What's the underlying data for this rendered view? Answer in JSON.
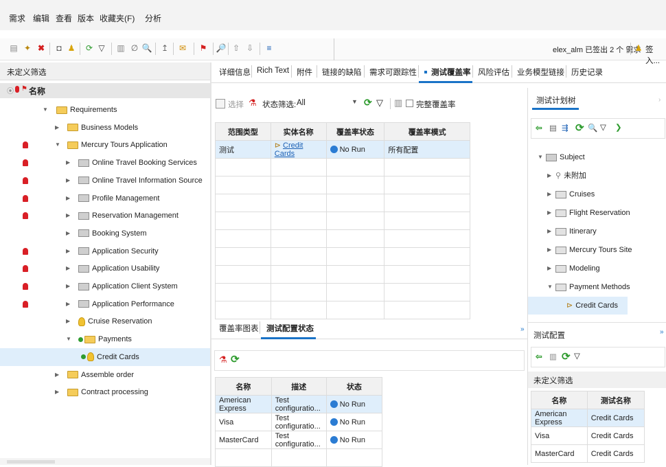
{
  "menu": [
    "需求",
    "编辑",
    "查看",
    "版本",
    "收藏夹(F)",
    "分析"
  ],
  "toolbar": {
    "user_status": "elex_alm 已签出 2 个 需求",
    "login": "签入..."
  },
  "left": {
    "filter_label": "未定义筛选",
    "name_header": "名称",
    "tree": [
      {
        "label": "Requirements",
        "bell": false,
        "arrow": "▼",
        "type": "folder"
      },
      {
        "label": "Business Models",
        "bell": false,
        "arrow": "▶",
        "type": "folder"
      },
      {
        "label": "Mercury Tours Application",
        "bell": true,
        "arrow": "▼",
        "type": "folder"
      },
      {
        "label": "Online Travel Booking Services",
        "bell": true,
        "arrow": "▶",
        "type": "gfolder"
      },
      {
        "label": "Online Travel Information Source",
        "bell": true,
        "arrow": "▶",
        "type": "gfolder"
      },
      {
        "label": "Profile Management",
        "bell": true,
        "arrow": "▶",
        "type": "gfolder"
      },
      {
        "label": "Reservation Management",
        "bell": true,
        "arrow": "▶",
        "type": "gfolder"
      },
      {
        "label": "Booking System",
        "bell": false,
        "arrow": "▶",
        "type": "gfolder"
      },
      {
        "label": "Application Security",
        "bell": true,
        "arrow": "▶",
        "type": "gfolder"
      },
      {
        "label": "Application Usability",
        "bell": true,
        "arrow": "▶",
        "type": "gfolder"
      },
      {
        "label": "Application Client System",
        "bell": true,
        "arrow": "▶",
        "type": "gfolder"
      },
      {
        "label": "Application Performance",
        "bell": true,
        "arrow": "▶",
        "type": "gfolder"
      },
      {
        "label": "Cruise Reservation",
        "bell": false,
        "arrow": "▶",
        "type": "bulb"
      },
      {
        "label": "Payments",
        "bell": false,
        "arrow": "▼",
        "type": "folder"
      },
      {
        "label": "Credit Cards",
        "bell": false,
        "arrow": "",
        "type": "bulb"
      },
      {
        "label": "Assemble order",
        "bell": false,
        "arrow": "▶",
        "type": "folder"
      },
      {
        "label": "Contract processing",
        "bell": false,
        "arrow": "▶",
        "type": "folder"
      }
    ]
  },
  "tabs": [
    "详细信息",
    "Rich Text",
    "附件",
    "链接的缺陷",
    "需求可跟踪性",
    "测试覆盖率",
    "风险评估",
    "业务模型链接",
    "历史记录"
  ],
  "coverage": {
    "select_label": "选择",
    "status_filter_label": "状态筛选:",
    "status_filter_value": "All",
    "full_coverage_label": "完整覆盖率",
    "headers": [
      "范围类型",
      "实体名称",
      "覆盖率状态",
      "覆盖率模式"
    ],
    "row": {
      "type": "测试",
      "entity": "Credit Cards",
      "status": "No Run",
      "mode": "所有配置"
    }
  },
  "bottom_tabs": [
    "覆盖率图表",
    "测试配置状态"
  ],
  "config": {
    "headers": [
      "名称",
      "描述",
      "状态"
    ],
    "rows": [
      {
        "name": "American Express",
        "desc": "Test configuratio...",
        "status": "No Run"
      },
      {
        "name": "Visa",
        "desc": "Test configuratio...",
        "status": "No Run"
      },
      {
        "name": "MasterCard",
        "desc": "Test configuratio...",
        "status": "No Run"
      }
    ]
  },
  "plan": {
    "title": "测试计划树",
    "tree": [
      {
        "label": "Subject",
        "arrow": "▼",
        "icon": "gray"
      },
      {
        "label": "未附加",
        "arrow": "▶",
        "icon": "unattached"
      },
      {
        "label": "Cruises",
        "arrow": "▶",
        "icon": "folder"
      },
      {
        "label": "Flight Reservation",
        "arrow": "▶",
        "icon": "folder"
      },
      {
        "label": "Itinerary",
        "arrow": "▶",
        "icon": "folder"
      },
      {
        "label": "Mercury Tours Site",
        "arrow": "▶",
        "icon": "folder"
      },
      {
        "label": "Modeling",
        "arrow": "▶",
        "icon": "folder"
      },
      {
        "label": "Payment Methods",
        "arrow": "▼",
        "icon": "folder"
      },
      {
        "label": "Credit Cards",
        "arrow": "",
        "icon": "test"
      }
    ]
  },
  "test_config": {
    "title": "测试配置",
    "filter_label": "未定义筛选",
    "headers": [
      "名称",
      "测试名称"
    ],
    "rows": [
      {
        "name": "American Express",
        "test": "Credit Cards"
      },
      {
        "name": "Visa",
        "test": "Credit Cards"
      },
      {
        "name": "MasterCard",
        "test": "Credit Cards"
      }
    ]
  }
}
